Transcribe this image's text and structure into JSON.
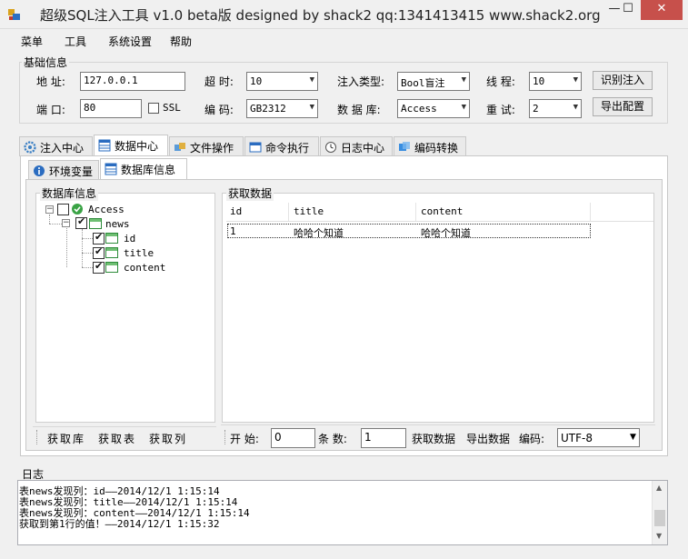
{
  "window": {
    "title": "超级SQL注入工具 v1.0 beta版 designed by shack2 qq:1341413415 www.shack2.org",
    "min_glyph": "—",
    "max_glyph": "☐",
    "close_glyph": "✕"
  },
  "menu": {
    "items": [
      "菜单",
      "工具",
      "系统设置",
      "帮助"
    ]
  },
  "basic": {
    "group_label": "基础信息",
    "address_label": "地 址:",
    "address_value": "127.0.0.1",
    "timeout_label": "超 时:",
    "timeout_value": "10",
    "inject_type_label": "注入类型:",
    "inject_type_value": "Bool盲注",
    "threads_label": "线 程:",
    "threads_value": "10",
    "identify_button": "识别注入",
    "port_label": "端 口:",
    "port_value": "80",
    "ssl_label": "SSL",
    "encoding_label": "编 码:",
    "encoding_value": "GB2312",
    "database_label": "数 据 库:",
    "database_value": "Access",
    "retry_label": "重 试:",
    "retry_value": "2",
    "export_button": "导出配置"
  },
  "tabs": [
    {
      "label": "注入中心",
      "icon": "gear-icon"
    },
    {
      "label": "数据中心",
      "icon": "database-icon"
    },
    {
      "label": "文件操作",
      "icon": "puzzle-icon"
    },
    {
      "label": "命令执行",
      "icon": "window-icon"
    },
    {
      "label": "日志中心",
      "icon": "clock-icon"
    },
    {
      "label": "编码转换",
      "icon": "convert-icon"
    }
  ],
  "subtabs": [
    {
      "label": "环境变量",
      "icon": "info-icon"
    },
    {
      "label": "数据库信息",
      "icon": "database-icon"
    }
  ],
  "dbinfo": {
    "group_label": "数据库信息",
    "tree": {
      "root": "Access",
      "table": "news",
      "columns": [
        "id",
        "title",
        "content"
      ]
    },
    "toolbar": [
      "获取库",
      "获取表",
      "获取列"
    ]
  },
  "fetch": {
    "group_label": "获取数据",
    "columns": [
      "id",
      "title",
      "content"
    ],
    "rows": [
      [
        "1",
        "哈哈个知道",
        "哈哈个知道"
      ]
    ],
    "start_label": "开 始:",
    "start_value": "0",
    "count_label": "条 数:",
    "count_value": "1",
    "fetch_button": "获取数据",
    "export_button": "导出数据",
    "encoding_label": "编码:",
    "encoding_value": "UTF-8"
  },
  "log": {
    "label": "日志",
    "lines": [
      "表news发现列：id——2014/12/1 1:15:14",
      "表news发现列：title——2014/12/1 1:15:14",
      "表news发现列：content——2014/12/1 1:15:14",
      "获取到第1行的值！——2014/12/1 1:15:32"
    ]
  }
}
